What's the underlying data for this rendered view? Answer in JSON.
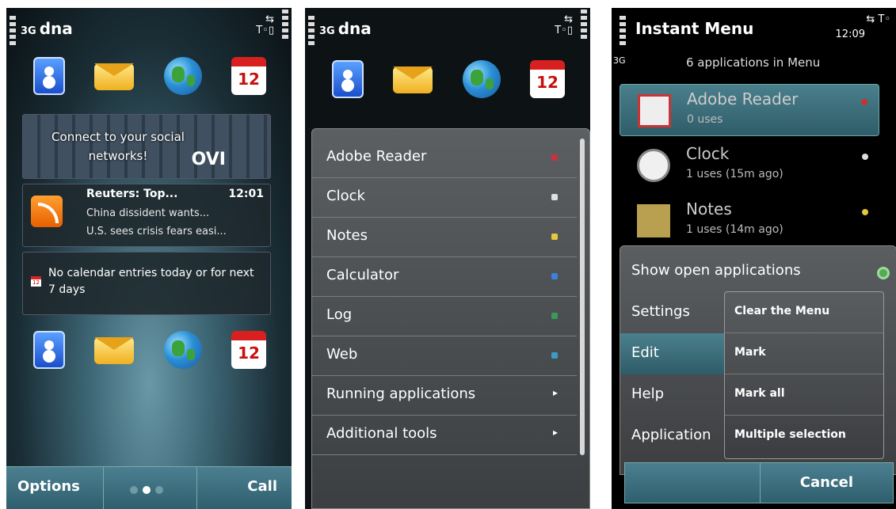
{
  "screen1": {
    "operator": "dna",
    "network": "3G",
    "social_widget": {
      "line1": "Connect to your social",
      "line2": "networks!",
      "brand": "OVI"
    },
    "news_widget": {
      "title": "Reuters: Top...",
      "time": "12:01",
      "line1": "China dissident wants...",
      "line2": "U.S. sees crisis fears easi..."
    },
    "calendar_widget": {
      "text": "No calendar entries today or for next 7 days",
      "icon_day": "12"
    },
    "calendar_icon_day": "12",
    "softkeys": {
      "left": "Options",
      "right": "Call"
    },
    "page_indicator": {
      "total": 3,
      "active": 2
    }
  },
  "screen2": {
    "operator": "dna",
    "network": "3G",
    "calendar_icon_day": "12",
    "menu": [
      {
        "label": "Adobe Reader",
        "marker": "#c8323c"
      },
      {
        "label": "Clock",
        "marker": "#e0e0e0"
      },
      {
        "label": "Notes",
        "marker": "#e6c83c"
      },
      {
        "label": "Calculator",
        "marker": "#3c82dc"
      },
      {
        "label": "Log",
        "marker": "#3a9a5a"
      },
      {
        "label": "Web",
        "marker": "#3c9ac8"
      },
      {
        "label": "Running applications",
        "submenu": true
      },
      {
        "label": "Additional tools",
        "submenu": true
      }
    ]
  },
  "screen3": {
    "title": "Instant Menu",
    "time": "12:09",
    "network": "3G",
    "subtitle": "6 applications in Menu",
    "apps": [
      {
        "name": "Adobe Reader",
        "uses": "0 uses",
        "marker": "#c83232"
      },
      {
        "name": "Clock",
        "uses": "1 uses (15m ago)",
        "marker": "#dddddd"
      },
      {
        "name": "Notes",
        "uses": "1 uses (14m ago)",
        "marker": "#e6c83c"
      }
    ],
    "options": [
      "Show open applications",
      "Settings",
      "Edit",
      "Help",
      "Application"
    ],
    "submenu": [
      "Clear the Menu",
      "Mark",
      "Mark all",
      "Multiple selection"
    ],
    "softkey_right": "Cancel"
  }
}
